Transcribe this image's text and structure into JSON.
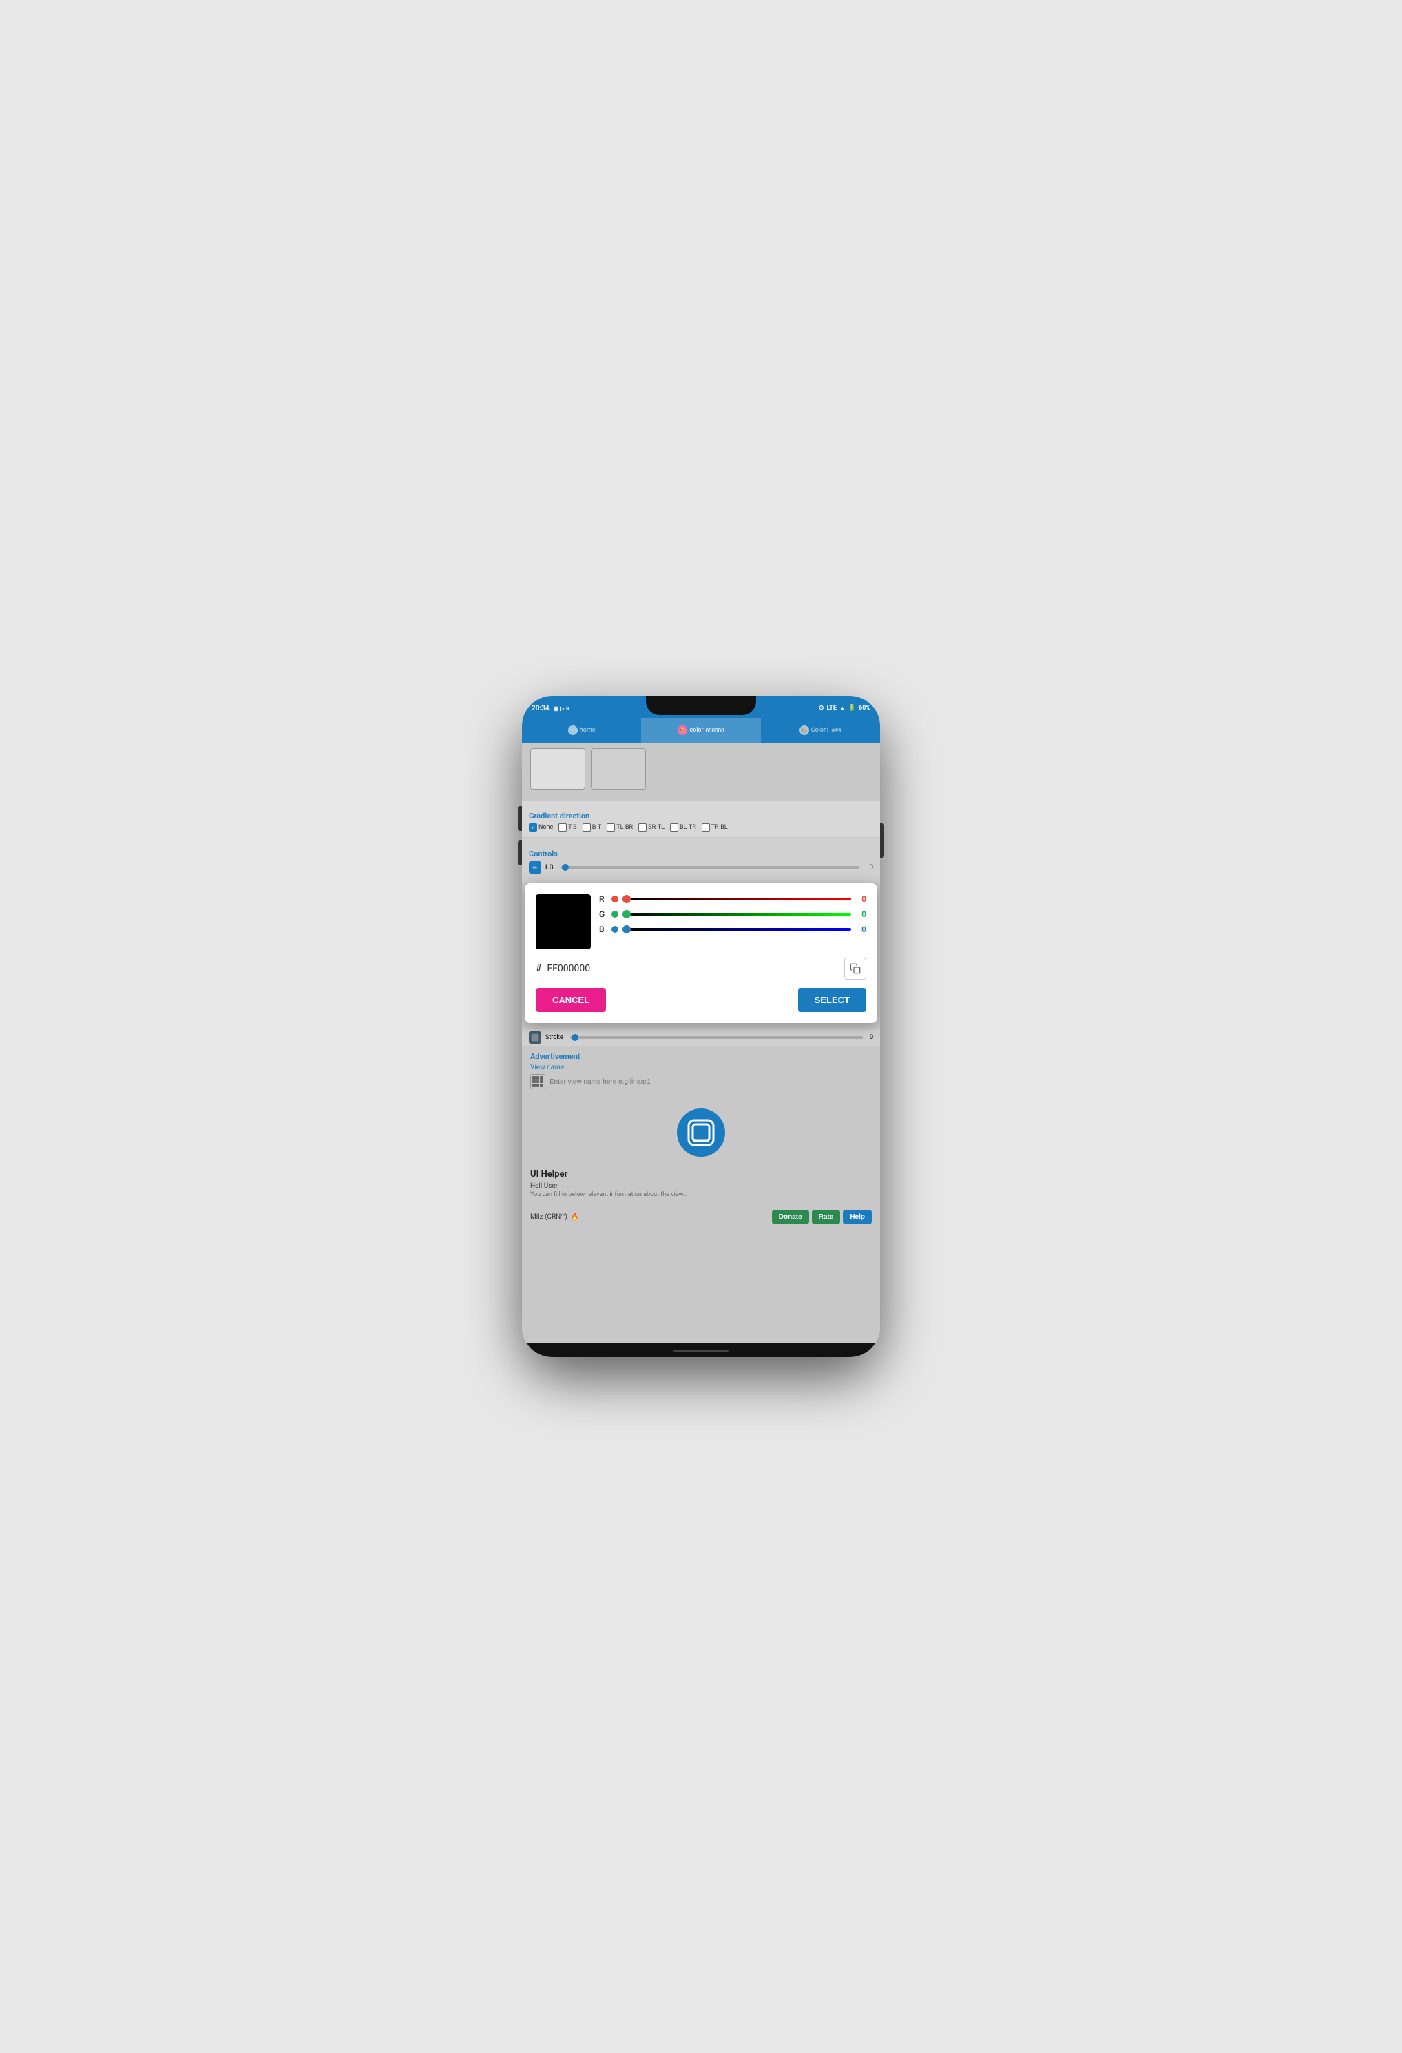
{
  "device": {
    "time": "20:34",
    "battery": "60%",
    "network": "LTE"
  },
  "tabs": [
    {
      "label": "home",
      "active": false
    },
    {
      "label": "color",
      "active": true,
      "hex": "000000"
    },
    {
      "label": "Color1",
      "active": false,
      "hex": "###"
    }
  ],
  "gradient": {
    "title": "Gradient direction",
    "options": [
      "None",
      "T-B",
      "B-T",
      "TL-BR",
      "BR-TL",
      "BL-TR",
      "TR-BL"
    ],
    "selected": "None"
  },
  "controls": {
    "title": "Controls",
    "lb_label": "LB",
    "lb_value": "0",
    "stroke_label": "Stroke",
    "stroke_value": "0"
  },
  "color_dialog": {
    "r_label": "R",
    "r_value": "0",
    "g_label": "G",
    "g_value": "0",
    "b_label": "B",
    "b_value": "0",
    "hex_prefix": "#",
    "hex_value": "FF000000",
    "cancel_label": "CANCEL",
    "select_label": "SELECT"
  },
  "advertisement": {
    "title": "Advertisement",
    "view_name_label": "View name",
    "view_name_placeholder": "Enter view name here e.g linear1"
  },
  "helper": {
    "title": "UI Helper",
    "greeting": "Hell User,",
    "description": "..."
  },
  "bottom": {
    "creator": "Milz (CRN™)",
    "donate_label": "Donate",
    "rate_label": "Rate",
    "help_label": "Help"
  }
}
